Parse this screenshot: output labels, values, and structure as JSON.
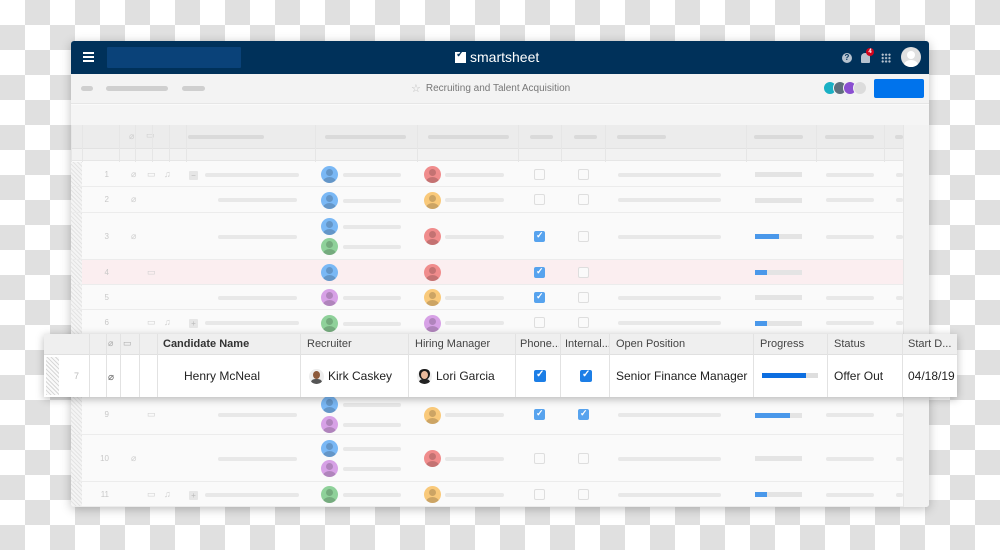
{
  "app": {
    "brand": "smartsheet",
    "notification_count": "4"
  },
  "toolbar": {
    "sheet_title": "Recruiting and Talent Acquisition"
  },
  "icons": {
    "menu": "hamburger-menu-icon",
    "logo": "smartsheet-check-icon",
    "help": "?",
    "bell": "bell-icon",
    "apps": "apps-grid-icon",
    "star": "☆",
    "attachment": "📎",
    "comment": "🗨"
  },
  "colors": {
    "topbar": "#00315a",
    "accent": "#0073ec",
    "checkbox": "#1c7ee6",
    "progress": "#0d6ee0",
    "highlight_row": "#fbeef0",
    "badge": "#d0021b"
  },
  "collaborators": [
    "#19b0c4",
    "#5f6f7c",
    "#8a4fd1",
    "#dcdcdc"
  ],
  "grid": {
    "rows": [
      {
        "num": "1",
        "attach": true,
        "comment": true,
        "bell": true,
        "expand": "−",
        "recruiters": [
          "#7ab8f5"
        ],
        "manager": "#f08c8c",
        "phone": false,
        "internal": false,
        "progress": 0
      },
      {
        "num": "2",
        "attach": true,
        "comment": false,
        "bell": false,
        "expand": "",
        "recruiters": [
          "#7ab8f5"
        ],
        "manager": "#f9c97a",
        "phone": false,
        "internal": false,
        "progress": 0
      },
      {
        "num": "3",
        "attach": true,
        "comment": false,
        "bell": false,
        "expand": "",
        "recruiters": [
          "#7ab8f5",
          "#8fd19a"
        ],
        "manager": "#f08c8c",
        "phone": true,
        "internal": false,
        "progress": 0.5
      },
      {
        "num": "4",
        "attach": false,
        "comment": true,
        "bell": false,
        "expand": "",
        "recruiters": [
          "#7ab8f5"
        ],
        "manager": "#f08c8c",
        "phone": true,
        "internal": false,
        "progress": 0.25,
        "highlight": true
      },
      {
        "num": "5",
        "attach": false,
        "comment": false,
        "bell": false,
        "expand": "",
        "recruiters": [
          "#d7a1e6"
        ],
        "manager": "#f9c97a",
        "phone": true,
        "internal": false,
        "progress": 0
      },
      {
        "num": "6",
        "attach": false,
        "comment": true,
        "bell": true,
        "expand": "+",
        "recruiters": [
          "#8fd19a"
        ],
        "manager": "#d7a1e6",
        "phone": false,
        "internal": false,
        "progress": 0.25
      },
      {
        "num": "9",
        "attach": false,
        "comment": true,
        "bell": false,
        "expand": "",
        "recruiters": [
          "#7ab8f5",
          "#d7a1e6"
        ],
        "manager": "#f9c97a",
        "phone": true,
        "internal": true,
        "progress": 0.75
      },
      {
        "num": "10",
        "attach": true,
        "comment": false,
        "bell": false,
        "expand": "",
        "recruiters": [
          "#7ab8f5",
          "#d7a1e6"
        ],
        "manager": "#f08c8c",
        "phone": false,
        "internal": false,
        "progress": 0
      },
      {
        "num": "11",
        "attach": false,
        "comment": true,
        "bell": true,
        "expand": "+",
        "recruiters": [
          "#8fd19a"
        ],
        "manager": "#f9c97a",
        "phone": false,
        "internal": false,
        "progress": 0.25
      }
    ]
  },
  "focused_row": {
    "headers": {
      "candidate_name": "Candidate Name",
      "recruiter": "Recruiter",
      "hiring_manager": "Hiring Manager",
      "phone": "Phone...",
      "internal": "Internal...",
      "open_position": "Open Position",
      "progress": "Progress",
      "status": "Status",
      "start_date": "Start D..."
    },
    "row_number": "7",
    "candidate_name": "Henry McNeal",
    "recruiter": "Kirk Caskey",
    "hiring_manager": "Lori Garcia",
    "phone_screen": true,
    "internal_interview": true,
    "open_position": "Senior Finance Manager",
    "progress": 0.78,
    "status": "Offer Out",
    "start_date": "04/18/19"
  }
}
